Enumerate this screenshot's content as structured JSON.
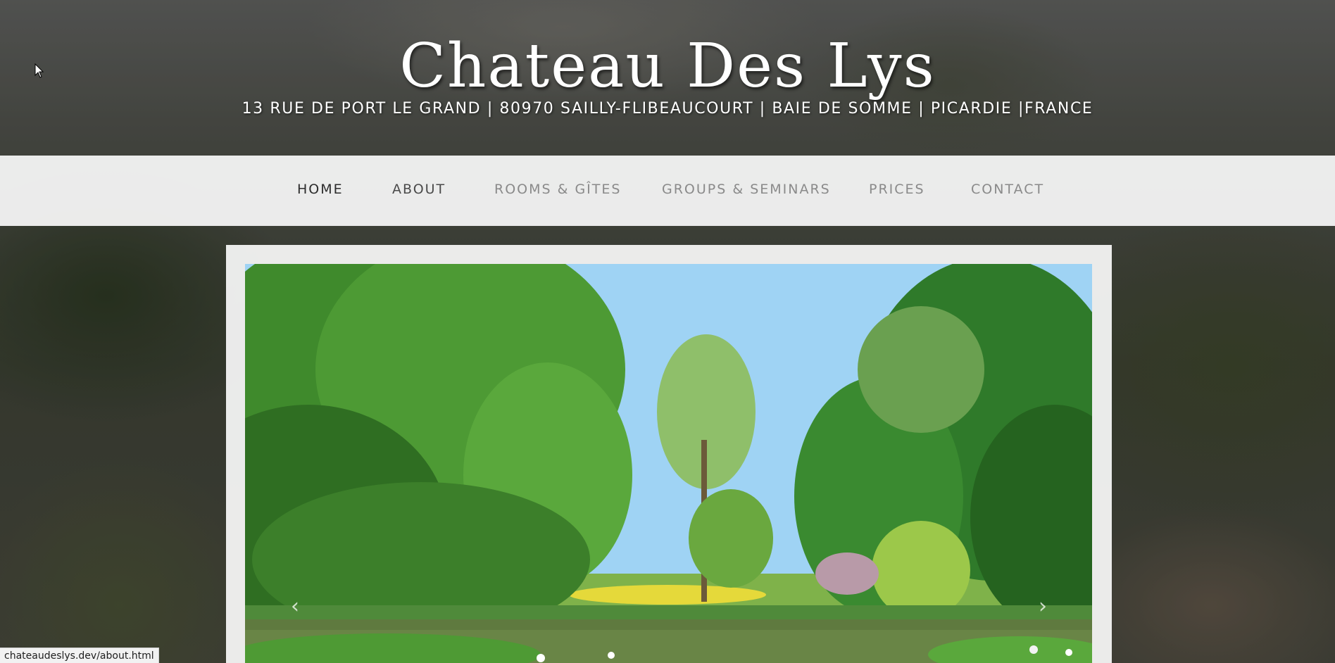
{
  "header": {
    "title": "Chateau Des Lys",
    "address": "13 RUE DE PORT LE GRAND | 80970 SAILLY-FLIBEAUCOURT | BAIE DE SOMME | PICARDIE |FRANCE"
  },
  "nav": {
    "items": [
      {
        "label": "HOME",
        "state": "active"
      },
      {
        "label": "ABOUT",
        "state": "hover"
      },
      {
        "label": "ROOMS & GÎTES",
        "state": "normal"
      },
      {
        "label": "GROUPS & SEMINARS",
        "state": "normal"
      },
      {
        "label": "PRICES",
        "state": "normal"
      },
      {
        "label": "CONTACT",
        "state": "normal"
      }
    ]
  },
  "slider": {
    "prev_icon": "chevron-left-icon",
    "next_icon": "chevron-right-icon",
    "prev_glyph": "‹",
    "next_glyph": "›"
  },
  "status_bar": {
    "url": "chateaudeslys.dev/about.html"
  },
  "colors": {
    "nav_background": "#f6f6f6",
    "nav_active": "#2c2c2c",
    "nav_normal": "#8a8a8a",
    "title_text": "#ffffff"
  }
}
